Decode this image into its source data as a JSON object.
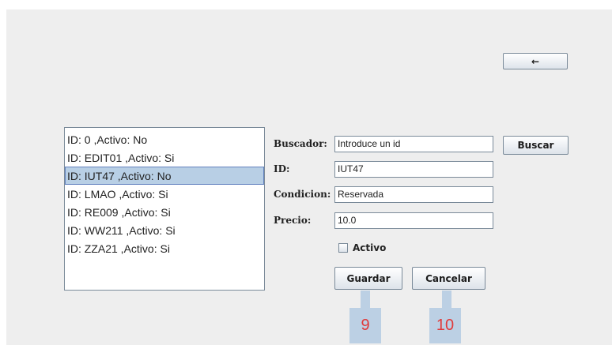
{
  "toolbar": {
    "back_glyph": "←"
  },
  "list": {
    "items": [
      {
        "label": "ID: 0 ,Activo: No",
        "selected": false
      },
      {
        "label": "ID: EDIT01 ,Activo: Si",
        "selected": false
      },
      {
        "label": "ID: IUT47 ,Activo: No",
        "selected": true
      },
      {
        "label": "ID: LMAO ,Activo: Si",
        "selected": false
      },
      {
        "label": "ID: RE009 ,Activo: Si",
        "selected": false
      },
      {
        "label": "ID: WW211 ,Activo: Si",
        "selected": false
      },
      {
        "label": "ID: ZZA21 ,Activo: Si",
        "selected": false
      }
    ]
  },
  "form": {
    "buscador_label": "Buscador:",
    "buscador_value": "Introduce un id",
    "buscar_label": "Buscar",
    "id_label": "ID:",
    "id_value": "IUT47",
    "condicion_label": "Condicion:",
    "condicion_value": "Reservada",
    "precio_label": "Precio:",
    "precio_value": "10.0",
    "activo_label": "Activo",
    "activo_checked": false,
    "guardar_label": "Guardar",
    "cancelar_label": "Cancelar"
  },
  "markers": {
    "guardar": "9",
    "cancelar": "10"
  }
}
